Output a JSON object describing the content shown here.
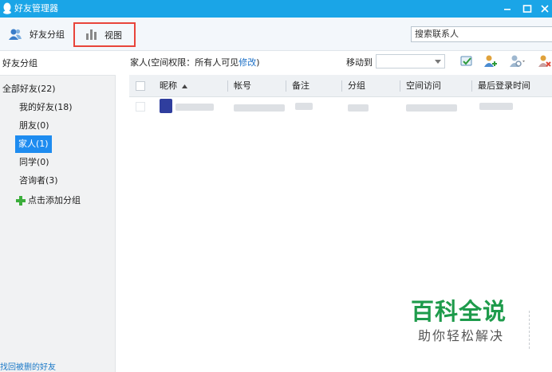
{
  "window": {
    "title": "好友管理器",
    "controls": [
      "minimize",
      "maximize",
      "close"
    ]
  },
  "toolbar": {
    "friend_groups_label": "好友分组",
    "view_label": "视图",
    "search_placeholder": "搜索联系人"
  },
  "sidebar": {
    "header": "好友分组",
    "all_friends": "全部好友(22)",
    "groups": [
      {
        "label": "我的好友(18)",
        "selected": false
      },
      {
        "label": "朋友(0)",
        "selected": false
      },
      {
        "label": "家人(1)",
        "selected": true
      },
      {
        "label": "同学(0)",
        "selected": false
      },
      {
        "label": "咨询者(3)",
        "selected": false
      }
    ],
    "add_group": "点击添加分组",
    "bottom_link": "找回被删的好友"
  },
  "main": {
    "group_info_prefix": "家人(空间权限：所有人可见",
    "group_info_link": "修改",
    "group_info_suffix": ")",
    "move_to_label": "移动到",
    "move_to_value": "",
    "icons": [
      "send-message-icon",
      "add-contact-icon",
      "contact-settings-icon",
      "remove-contact-icon"
    ]
  },
  "table": {
    "columns": [
      "昵称",
      "帐号",
      "备注",
      "分组",
      "空间访问",
      "最后登录时间"
    ],
    "sort": {
      "column": "昵称",
      "direction": "asc"
    }
  },
  "watermark": {
    "title": "百科全说",
    "subtitle": "助你轻松解决"
  },
  "colors": {
    "titlebar": "#1aa5e7",
    "selection": "#1e8cf0",
    "highlight_border": "#e8443a",
    "link": "#1b6fc6",
    "watermark_green": "#1e9b4b"
  }
}
